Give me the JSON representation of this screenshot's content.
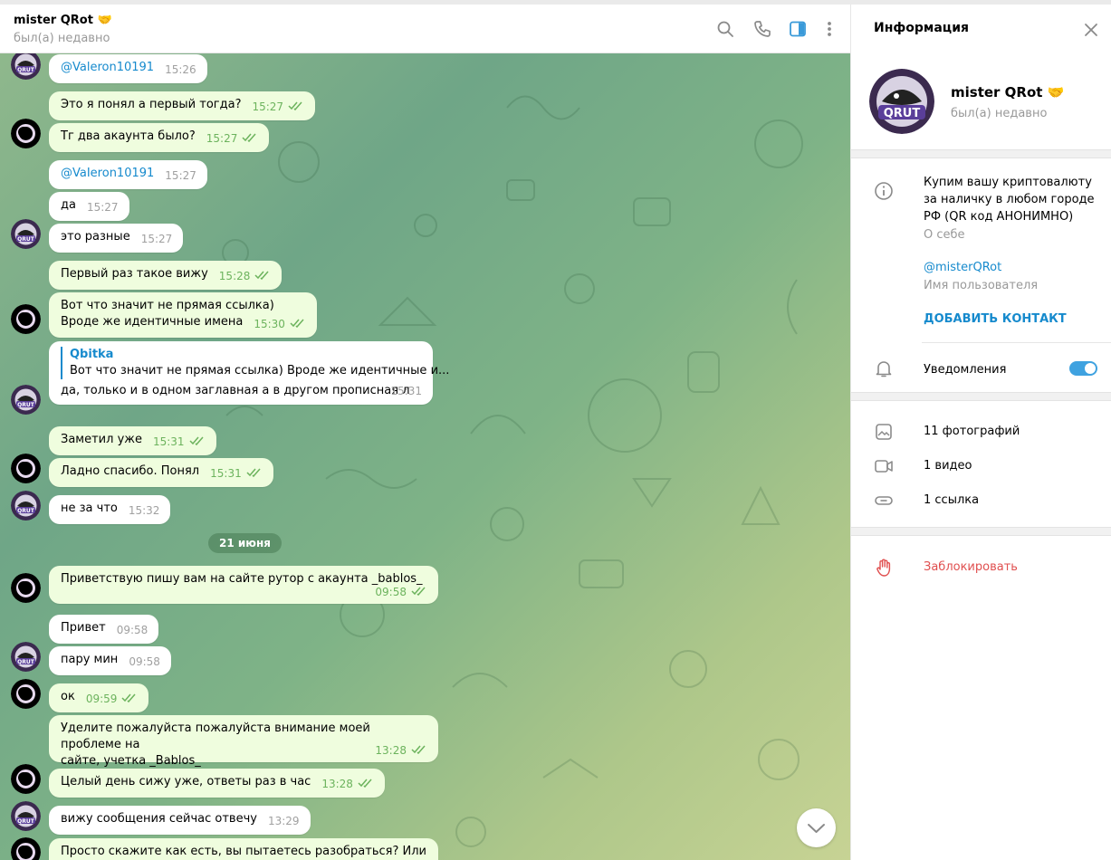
{
  "chat": {
    "title": "mister QRot 🤝",
    "status": "был(а) недавно"
  },
  "messages": [
    {
      "text": "@Valeron10191",
      "time": "15:26",
      "mention": true
    },
    {
      "text": "Это я понял а первый тогда?",
      "time": "15:27"
    },
    {
      "text": "Тг два акаунта было?",
      "time": "15:27"
    },
    {
      "text": "@VaIeron10191",
      "time": "15:27",
      "mention": true
    },
    {
      "text": "да",
      "time": "15:27"
    },
    {
      "text": "это разные",
      "time": "15:27"
    },
    {
      "text": "Первый раз такое вижу",
      "time": "15:28"
    },
    {
      "text": "Вот что значит не прямая ссылка)\nВроде же идентичные имена",
      "time": "15:30"
    },
    {
      "reply_name": "Qbitka",
      "reply_text": "Вот что значит не прямая ссылка) Вроде же идентичные и...",
      "text": "да, только и в одном заглавная а в другом прописная л",
      "time": "15:31"
    },
    {
      "text": "Заметил уже",
      "time": "15:31"
    },
    {
      "text": "Ладно спасибо. Понял",
      "time": "15:31"
    },
    {
      "text": "не за что",
      "time": "15:32"
    },
    {
      "text": "Приветствую пишу вам на сайте рутор с акаунта _bablos_",
      "time": "09:58"
    },
    {
      "text": "Привет",
      "time": "09:58"
    },
    {
      "text": "пару мин",
      "time": "09:58"
    },
    {
      "text": "ок",
      "time": "09:59"
    },
    {
      "text": "Уделите пожалуйста пожалуйста внимание моей проблеме на\nсайте, учетка _Bablos_",
      "time": "13:28"
    },
    {
      "text": "Целый день сижу уже, ответы раз в час",
      "time": "13:28"
    },
    {
      "text": "вижу сообщения сейчас отвечу",
      "time": "13:29"
    },
    {
      "text": "Просто скажите как есть, вы пытаетесь разобраться? Или вы"
    }
  ],
  "date_separator": "21 июня",
  "info": {
    "title": "Информация",
    "name": "mister QRot 🤝",
    "status": "был(а) недавно",
    "bio": "Купим вашу криптовалюту\nза наличку в любом городе\nРФ (QR код АНОНИМНО)",
    "bio_label": "О себе",
    "username": "@misterQRot",
    "username_label": "Имя пользователя",
    "add_contact": "ДОБАВИТЬ КОНТАКТ",
    "notifications": "Уведомления",
    "notifications_on": true,
    "photos": "11 фотографий",
    "videos": "1 видео",
    "links": "1 ссылка",
    "block": "Заблокировать"
  },
  "icons": {
    "search": "search-icon",
    "call": "phone-icon",
    "sidebar": "sidebar-toggle-icon",
    "more": "more-vertical-icon",
    "close": "close-icon",
    "info": "info-icon",
    "bell": "bell-icon",
    "photo": "photo-icon",
    "video": "video-icon",
    "link": "link-icon",
    "block": "hand-block-icon",
    "scroll": "chevron-down-icon"
  },
  "colors": {
    "accent": "#168acd",
    "outgoing_bubble": "#effdde",
    "incoming_bubble": "#ffffff",
    "danger": "#e04f4f",
    "read_check": "#6cb35d"
  }
}
